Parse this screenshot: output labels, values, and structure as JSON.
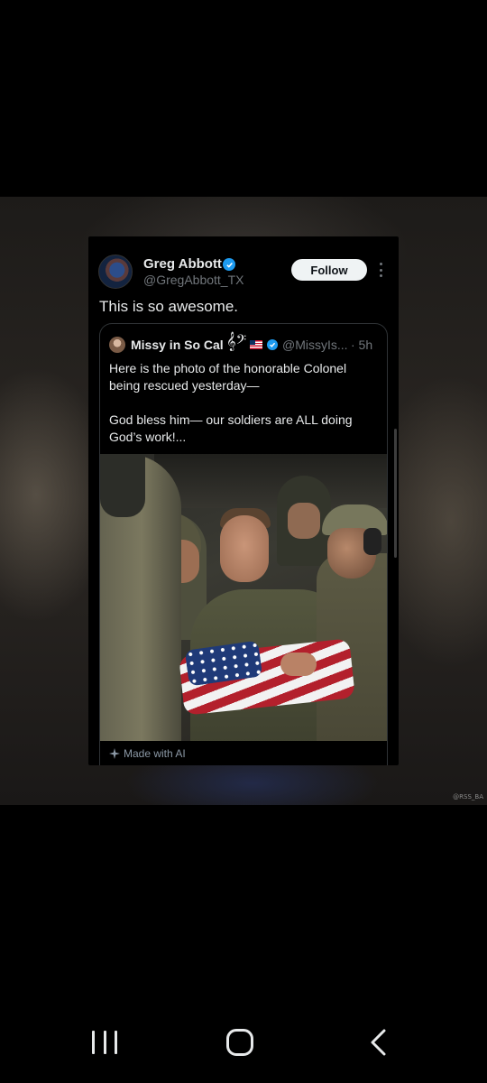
{
  "tweet": {
    "author_name": "Greg Abbott",
    "author_handle": "@GregAbbott_TX",
    "follow_label": "Follow",
    "text": "This is so awesome.",
    "icons": [
      "avatar",
      "verified-badge-icon",
      "more-options-icon"
    ]
  },
  "quoted": {
    "author_name": "Missy in So Cal",
    "name_glyphs": "𝄞𝄢",
    "handle": "@MissyIs...",
    "time": "· 5h",
    "text": "Here is the photo of the honorable Colonel being rescued yesterday—\n\nGod bless him— our soldiers are ALL doing God’s work!...",
    "ai_label": "Made with AI",
    "icons": [
      "us-flag-icon",
      "verified-badge-icon",
      "sparkle-icon"
    ]
  },
  "watermark": "@RSS_BA",
  "nav": {
    "icons": [
      "recent-apps-icon",
      "home-icon",
      "back-icon"
    ]
  },
  "colors": {
    "background": "#000000",
    "verified": "#1d9bf0",
    "text_primary": "#e7e9ea",
    "text_secondary": "#71767b",
    "follow_button": "#eff3f4"
  }
}
